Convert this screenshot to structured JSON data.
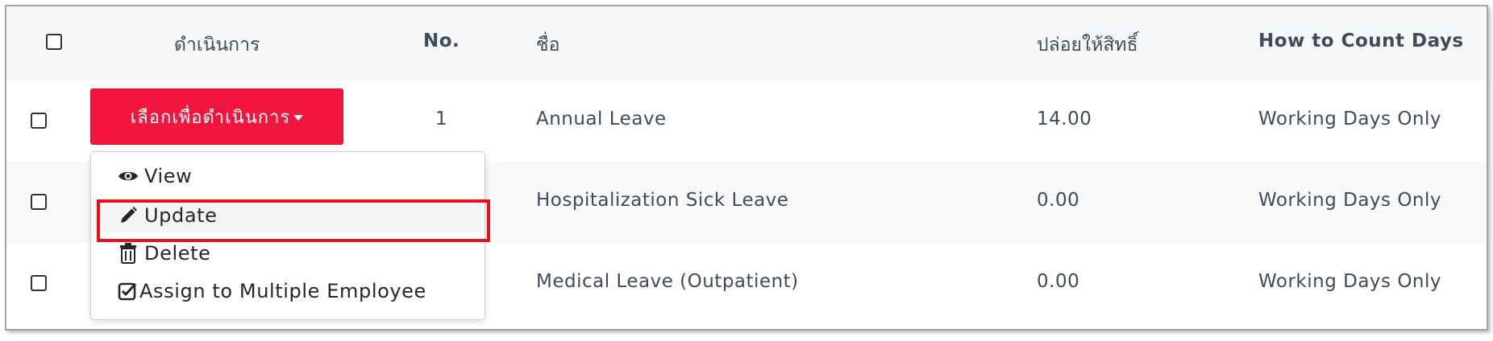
{
  "table": {
    "headers": {
      "action": "ดำเนินการ",
      "no": "No.",
      "name": "ชื่อ",
      "entitlement": "ปล่อยให้สิทธิ์",
      "count_days": "How to Count Days"
    },
    "rows": [
      {
        "no": "1",
        "name": "Annual Leave",
        "entitlement": "14.00",
        "count_days": "Working Days Only"
      },
      {
        "no": "",
        "name": "Hospitalization Sick Leave",
        "entitlement": "0.00",
        "count_days": "Working Days Only"
      },
      {
        "no": "",
        "name": "Medical Leave (Outpatient)",
        "entitlement": "0.00",
        "count_days": "Working Days Only"
      }
    ]
  },
  "action_button": {
    "label": "เลือกเพื่อดำเนินการ"
  },
  "dropdown": {
    "items": [
      {
        "label": "View",
        "icon": "eye-icon"
      },
      {
        "label": "Update",
        "icon": "pencil-icon"
      },
      {
        "label": "Delete",
        "icon": "trash-icon"
      },
      {
        "label": "Assign to Multiple Employee",
        "icon": "check-square-icon"
      }
    ]
  },
  "colors": {
    "accent": "#f2163f",
    "highlight": "#e8101e",
    "text": "#3d4b5c"
  }
}
